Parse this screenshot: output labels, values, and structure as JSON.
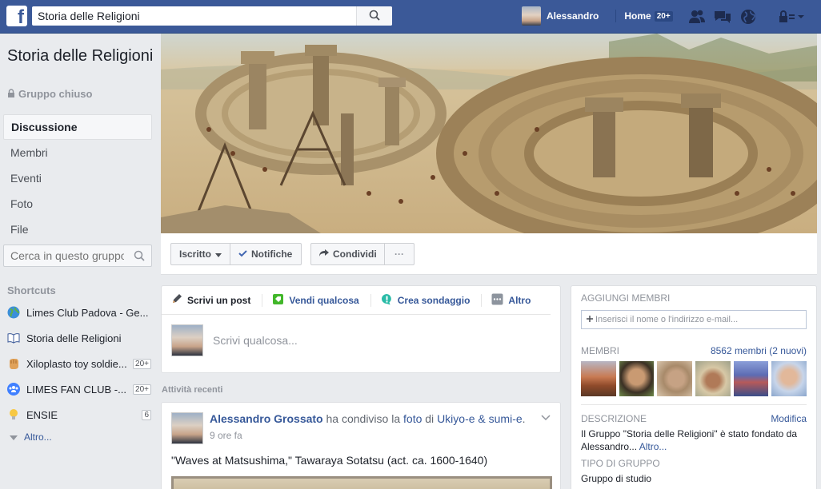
{
  "topbar": {
    "logo": "f",
    "search_value": "Storia delle Religioni",
    "user_name": "Alessandro",
    "home_label": "Home",
    "home_badge": "20+",
    "icons": [
      "friends-icon",
      "messages-icon",
      "globe-icon",
      "privacy-lock-icon",
      "account-dropdown-icon"
    ]
  },
  "group": {
    "title": "Storia delle Religioni",
    "type": "Gruppo chiuso",
    "nav": [
      "Discussione",
      "Membri",
      "Eventi",
      "Foto",
      "File"
    ],
    "search_placeholder": "Cerca in questo gruppo"
  },
  "shortcuts": {
    "heading": "Shortcuts",
    "items": [
      {
        "label": "Limes Club Padova - Ge...",
        "badge": "",
        "icon": "globe-icon"
      },
      {
        "label": "Storia delle Religioni",
        "badge": "",
        "icon": "book-icon"
      },
      {
        "label": "Xiloplasto toy soldie...",
        "badge": "20+",
        "icon": "fist-icon"
      },
      {
        "label": "LIMES FAN CLUB -...",
        "badge": "20+",
        "icon": "group-icon"
      },
      {
        "label": "ENSIE",
        "badge": "6",
        "icon": "lightbulb-icon"
      }
    ],
    "more": "Altro..."
  },
  "cover_actions": {
    "joined": "Iscritto",
    "notifications": "Notifiche",
    "share": "Condividi",
    "more": "···"
  },
  "composer": {
    "tabs": [
      "Scrivi un post",
      "Vendi qualcosa",
      "Crea sondaggio",
      "Altro"
    ],
    "placeholder": "Scrivi qualcosa..."
  },
  "feed": {
    "section_label": "Attività recenti",
    "post": {
      "actor": "Alessandro Grossato",
      "verb1": " ha condiviso la ",
      "object": "foto",
      "verb2": " di ",
      "page": "Ukiyo-e & sumi-e",
      "end": ".",
      "time": "9 ore fa",
      "text": "\"Waves at Matsushima,\" Tawaraya Sotatsu (act. ca. 1600-1640)"
    }
  },
  "sidebar_right": {
    "add_members_heading": "AGGIUNGI MEMBRI",
    "add_members_placeholder": "Inserisci il nome o l'indirizzo e-mail...",
    "members_heading": "MEMBRI",
    "members_count": "8562 membri (2 nuovi)",
    "description_heading": "DESCRIZIONE",
    "edit_label": "Modifica",
    "description_text": "Il Gruppo \"Storia delle Religioni\" è stato fondato da Alessandro...",
    "description_more": "Altro...",
    "type_heading": "TIPO DI GRUPPO",
    "type_value": "Gruppo di studio"
  }
}
